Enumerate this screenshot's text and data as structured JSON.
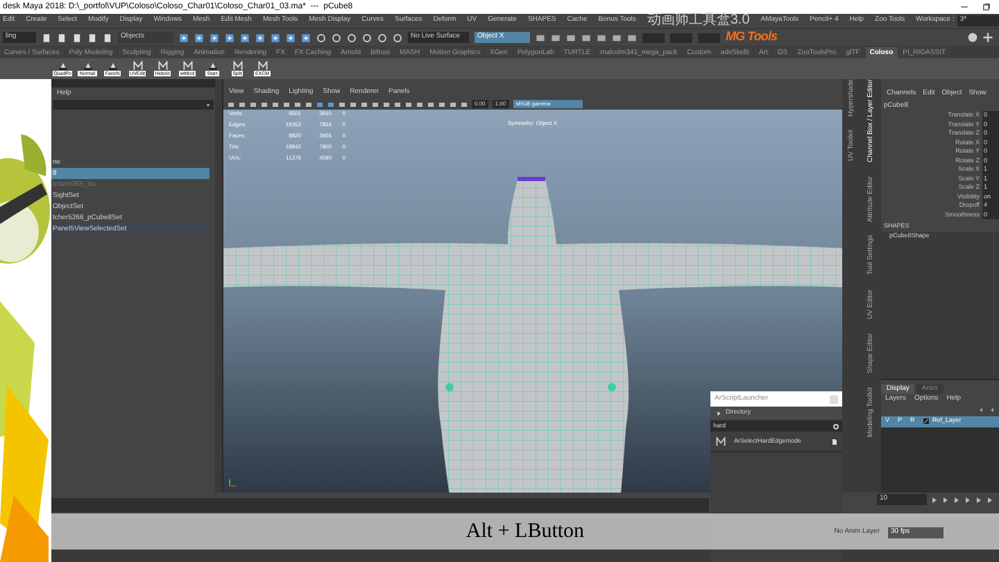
{
  "window": {
    "title": "desk Maya 2018: D:\\_portfol\\VUP\\Coloso\\Coloso_Char01\\Coloso_Char01_03.ma*  ---  pCube8"
  },
  "menu_bar": [
    "Edit",
    "Create",
    "Select",
    "Modify",
    "Display",
    "Windows",
    "Mesh",
    "Edit Mesh",
    "Mesh Tools",
    "Mesh Display",
    "Curves",
    "Surfaces",
    "Deform",
    "UV",
    "Generate",
    "SHAPES",
    "Cache",
    "Bonus Tools",
    "动画师工具盒3.0",
    "AMayaTools",
    "Pencil+ 4",
    "Help",
    "Zoo Tools"
  ],
  "toolbar": {
    "menu_set": "ling",
    "selection_mode": "Objects",
    "live_surface": "No Live Surface",
    "symmetry": "Object X",
    "logo": "MG Tools"
  },
  "workspace": {
    "label": "Workspace :",
    "value": "3*"
  },
  "shelf_tabs": [
    {
      "label": "Curves / Surfaces",
      "selected": false
    },
    {
      "label": "Poly Modeling",
      "selected": false
    },
    {
      "label": "Sculpting",
      "selected": false
    },
    {
      "label": "Rigging",
      "selected": false
    },
    {
      "label": "Animation",
      "selected": false
    },
    {
      "label": "Rendering",
      "selected": false
    },
    {
      "label": "FX",
      "selected": false
    },
    {
      "label": "FX Caching",
      "selected": false
    },
    {
      "label": "Arnold",
      "selected": false
    },
    {
      "label": "Bifrost",
      "selected": false
    },
    {
      "label": "MASH",
      "selected": false
    },
    {
      "label": "Motion Graphics",
      "selected": false
    },
    {
      "label": "XGen",
      "selected": false
    },
    {
      "label": "PolygonLab",
      "selected": false
    },
    {
      "label": "TURTLE",
      "selected": false
    },
    {
      "label": "malcolm341_mega_pack",
      "selected": false
    },
    {
      "label": "Custom",
      "selected": false
    },
    {
      "label": "advSkel5",
      "selected": false
    },
    {
      "label": "Art",
      "selected": false
    },
    {
      "label": "GS",
      "selected": false
    },
    {
      "label": "ZooToolsPro",
      "selected": false
    },
    {
      "label": "glTF",
      "selected": false
    },
    {
      "label": "Coloso",
      "selected": true
    },
    {
      "label": "PI_RIGASSIT",
      "selected": false
    }
  ],
  "shelf_buttons": [
    {
      "kind": "script",
      "label": "QuadPo"
    },
    {
      "kind": "script",
      "label": "Normal"
    },
    {
      "kind": "script",
      "label": "FaceN"
    },
    {
      "kind": "mel",
      "label": "UVEdit"
    },
    {
      "kind": "mel",
      "label": "HideAt"
    },
    {
      "kind": "mel",
      "label": "wtMod"
    },
    {
      "kind": "script",
      "label": "Start"
    },
    {
      "kind": "mel",
      "label": "Split"
    },
    {
      "kind": "mel",
      "label": "EXCM"
    }
  ],
  "outliner": {
    "menu": "Help",
    "items": [
      {
        "label": "ne",
        "selected": false,
        "dimmed": false
      },
      {
        "label": "8",
        "selected": true,
        "dimmed": false
      },
      {
        "label": "tcher5265_loc",
        "selected": false,
        "dimmed": true
      },
      {
        "label": "SightSet",
        "selected": false,
        "dimmed": false
      },
      {
        "label": "ObjectSet",
        "selected": false,
        "dimmed": false
      },
      {
        "label": "tcher5266_pCube8Set",
        "selected": false,
        "dimmed": false
      },
      {
        "label": "Panel5ViewSelectedSet",
        "selected": false,
        "dimmed": false
      }
    ]
  },
  "viewport": {
    "menus": [
      "View",
      "Shading",
      "Lighting",
      "Show",
      "Renderer",
      "Panels"
    ],
    "exposure": "0.00",
    "gamma": "1.00",
    "color_space": "sRGB gamma",
    "stats": [
      {
        "label": "Verts:",
        "values": [
          "9501",
          "3910",
          "0"
        ]
      },
      {
        "label": "Edges:",
        "values": [
          "19353",
          "7834",
          "0"
        ]
      },
      {
        "label": "Faces:",
        "values": [
          "9820",
          "3926",
          "0"
        ]
      },
      {
        "label": "Tris:",
        "values": [
          "18842",
          "7800",
          "0"
        ]
      },
      {
        "label": "UVs:",
        "values": [
          "11276",
          "4590",
          "0"
        ]
      }
    ],
    "symmetry": "Symmetry: Object X"
  },
  "side_tabs": {
    "outer": [
      "Hypershade",
      "UV Toolkit"
    ],
    "inner": [
      "Channel Box / Layer Editor",
      "Attribute Editor",
      "Tool Settings",
      "UV Editor",
      "Shape Editor",
      "Modeling Toolkit"
    ]
  },
  "channel_box": {
    "menus": [
      "Channels",
      "Edit",
      "Object",
      "Show"
    ],
    "object": "pCube8",
    "attributes": [
      {
        "name": "Translate X",
        "value": "0"
      },
      {
        "name": "Translate Y",
        "value": "0"
      },
      {
        "name": "Translate Z",
        "value": "0"
      },
      {
        "name": "Rotate X",
        "value": "0"
      },
      {
        "name": "Rotate Y",
        "value": "0"
      },
      {
        "name": "Rotate Z",
        "value": "0"
      },
      {
        "name": "Scale X",
        "value": "1"
      },
      {
        "name": "Scale Y",
        "value": "1"
      },
      {
        "name": "Scale Z",
        "value": "1"
      },
      {
        "name": "Visibility",
        "value": "on"
      },
      {
        "name": "Dropoff",
        "value": "4"
      },
      {
        "name": "Smoothness",
        "value": "0"
      }
    ],
    "shapes_label": "SHAPES",
    "shape": "pCube8Shape"
  },
  "layer_editor": {
    "tabs": [
      {
        "label": "Display",
        "selected": true
      },
      {
        "label": "Anim",
        "selected": false
      }
    ],
    "menus": [
      "Layers",
      "Options",
      "Help"
    ],
    "layers": [
      {
        "flags": [
          "V",
          "P",
          "R"
        ],
        "name": "Ref_Layer",
        "selected": true
      }
    ]
  },
  "script_launcher": {
    "title": "ArScriptLauncher",
    "section": "Directory",
    "search": "hard",
    "scripts": [
      "ArSelectHardEdgemode"
    ]
  },
  "time_slider": {
    "current_frame": "10",
    "anim_layer": "No Anim Layer",
    "fps": "30 fps"
  },
  "subtitle": "Alt + LButton"
}
